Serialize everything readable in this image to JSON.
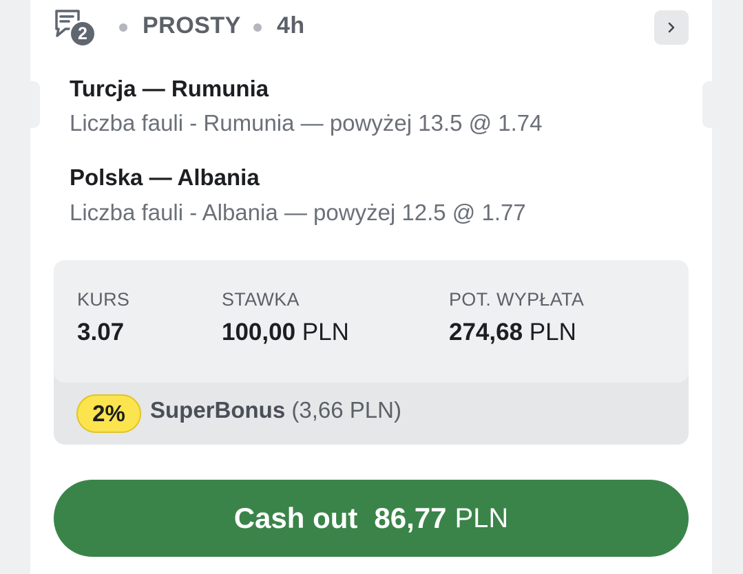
{
  "header": {
    "comments_count": "2",
    "bet_type": "PROSTY",
    "time_ago": "4h",
    "icons": {
      "comments": "chat-bubble-icon",
      "open_details": "chevron-right-icon"
    }
  },
  "selections": [
    {
      "match": "Turcja — Rumunia",
      "market": "Liczba fauli - Rumunia — powyżej 13.5 @ 1.74"
    },
    {
      "match": "Polska — Albania",
      "market": "Liczba fauli - Albania — powyżej 12.5 @ 1.77"
    }
  ],
  "summary": {
    "odds_label": "KURS",
    "odds_value": "3.07",
    "stake_label": "STAWKA",
    "stake_amount": "100,00",
    "stake_currency": "PLN",
    "payout_label": "POT. WYPŁATA",
    "payout_amount": "274,68",
    "payout_currency": "PLN"
  },
  "bonus": {
    "percent": "2%",
    "name": "SuperBonus",
    "amount": "(3,66 PLN)"
  },
  "cashout": {
    "label": "Cash out",
    "amount": "86,77",
    "currency": "PLN"
  },
  "colors": {
    "cashout_bg": "#3a8449",
    "bonus_badge": "#fbe44d",
    "page_bg": "#eff0f2"
  }
}
